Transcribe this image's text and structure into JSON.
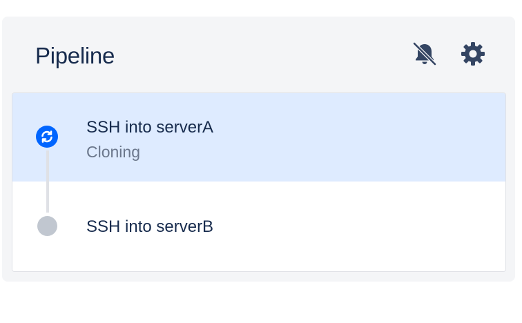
{
  "panel": {
    "title": "Pipeline",
    "icons": [
      "bell-snooze-icon",
      "gear-icon"
    ]
  },
  "steps": [
    {
      "name": "SSH into serverA",
      "status": "Cloning",
      "state": "running"
    },
    {
      "name": "SSH into serverB",
      "status": "",
      "state": "pending"
    }
  ],
  "colors": {
    "title": "#172b4d",
    "active_row": "#deebff",
    "running_icon": "#0065ff",
    "pending_dot": "#c1c7d0",
    "panel_bg": "#f4f5f7"
  }
}
